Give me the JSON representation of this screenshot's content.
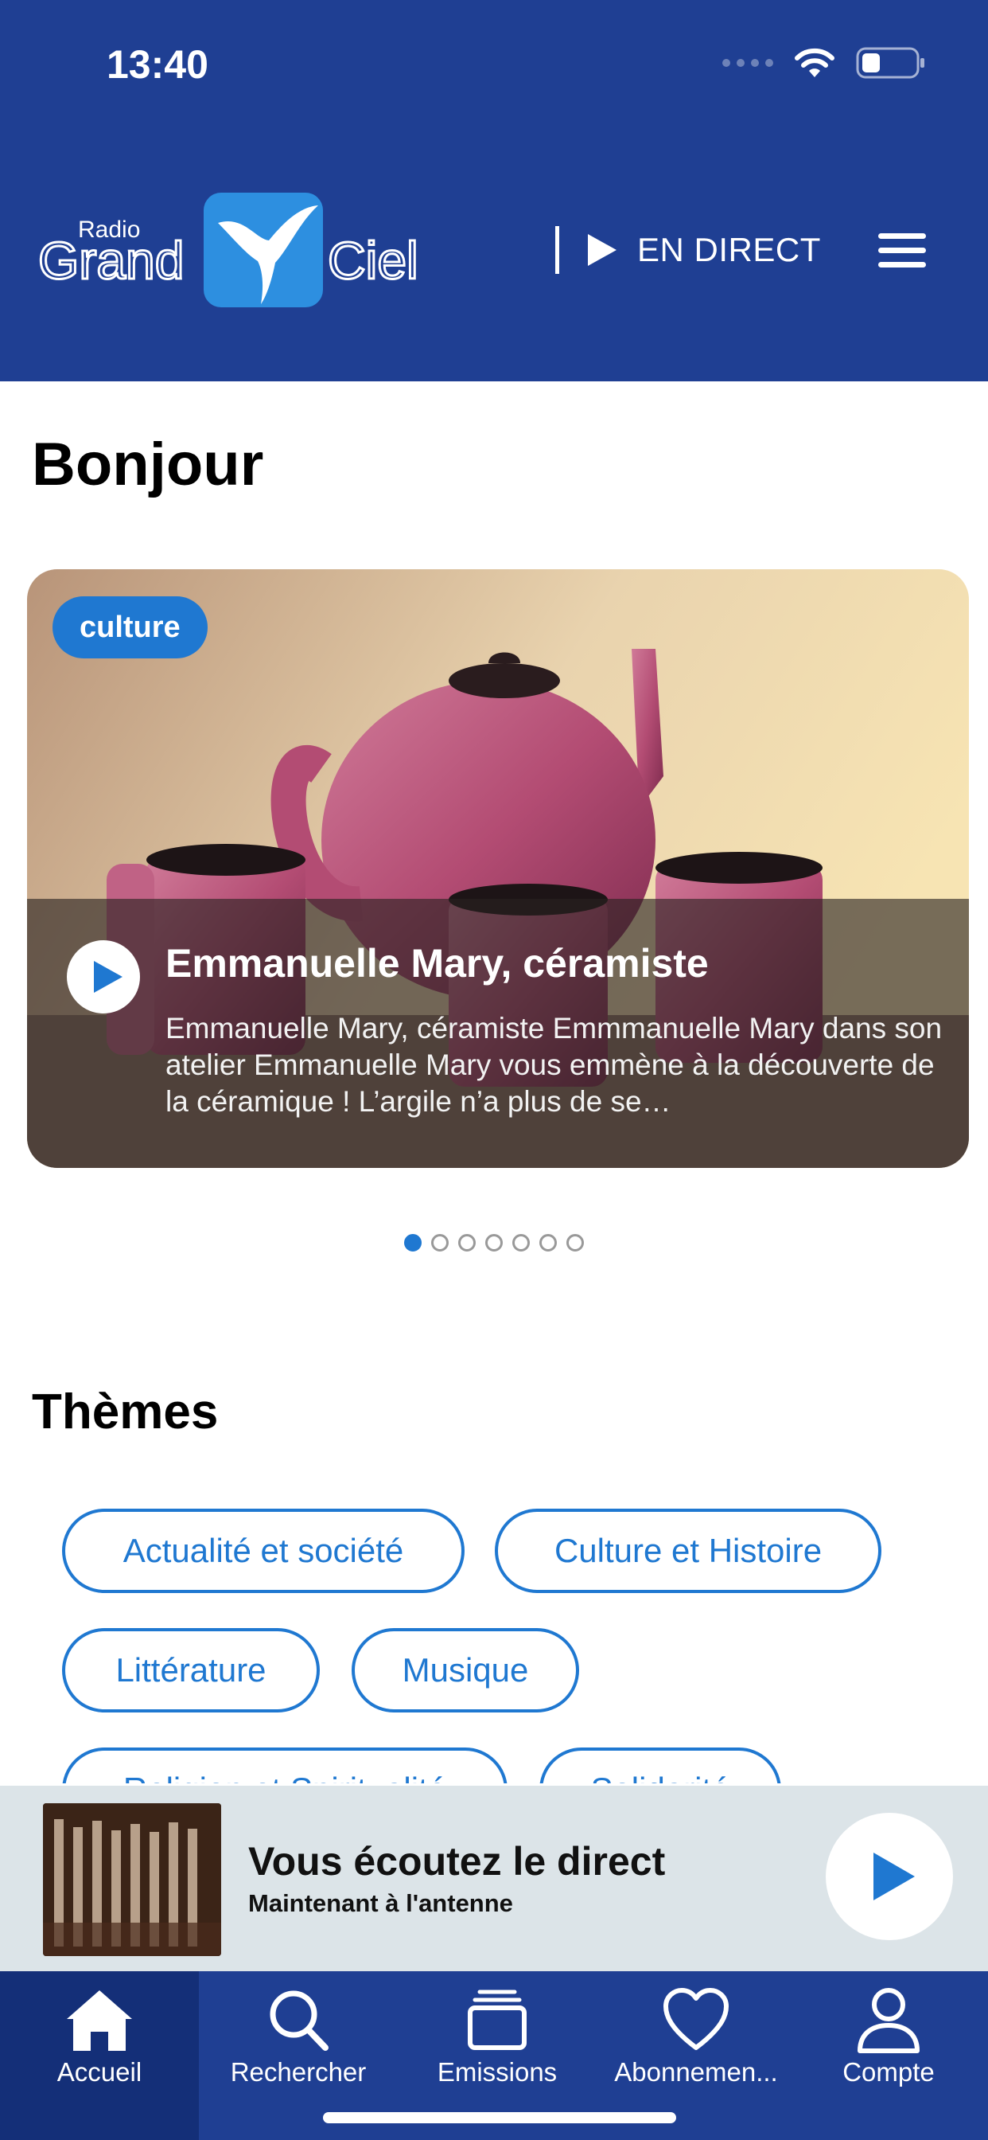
{
  "status_bar": {
    "time": "13:40",
    "battery_level": 0.3
  },
  "header": {
    "logo_text_small": "Radio",
    "logo_text_left": "Grand",
    "logo_text_right": "Ciel",
    "live_label": "EN DIRECT",
    "background_color": "#1f3f93"
  },
  "main": {
    "greeting": "Bonjour",
    "carousel": {
      "tag": "culture",
      "title": "Emmanuelle Mary, céramiste",
      "description": "Emmanuelle Mary, céramiste Emmmanuelle Mary dans son atelier Emmanuelle Mary vous emmène à la découverte de la céramique ! L’argile n’a plus de se…",
      "total_slides": 7,
      "active_slide": 1
    },
    "themes_title": "Thèmes",
    "themes": [
      "Actualité et société",
      "Culture et Histoire",
      "Littérature",
      "Musique",
      "Religion et Spiritualité",
      "Solidarité"
    ]
  },
  "player": {
    "title": "Vous écoutez le direct",
    "subtitle": "Maintenant à l'antenne"
  },
  "tabbar": {
    "tabs": [
      {
        "label": "Accueil",
        "icon": "home-icon",
        "active": true
      },
      {
        "label": "Rechercher",
        "icon": "search-icon",
        "active": false
      },
      {
        "label": "Emissions",
        "icon": "stack-icon",
        "active": false
      },
      {
        "label": "Abonnemen...",
        "icon": "heart-icon",
        "active": false
      },
      {
        "label": "Compte",
        "icon": "person-icon",
        "active": false
      }
    ]
  },
  "colors": {
    "accent": "#1f78d1",
    "navy": "#1f3f93",
    "player_bg": "#dce4e8"
  }
}
